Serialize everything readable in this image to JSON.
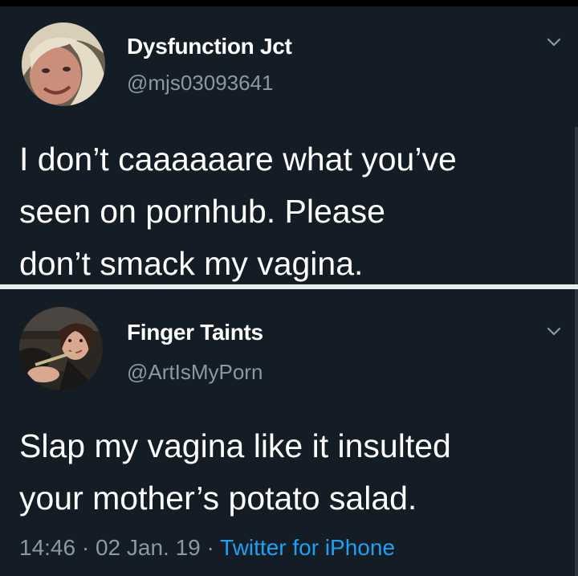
{
  "tweets": [
    {
      "display_name": "Dysfunction Jct",
      "handle": "@mjs03093641",
      "text": "I don’t caaaaaare what you’ve\nseen on pornhub.  Please\ndon’t smack my vagina.",
      "menu_icon": "chevron-down-icon"
    },
    {
      "display_name": "Finger Taints",
      "handle": "@ArtIsMyPorn",
      "text": "Slap my vagina like it insulted\nyour mother’s potato salad.",
      "menu_icon": "chevron-down-icon",
      "time": "14:46",
      "sep1": " · ",
      "date": "02 Jan. 19",
      "sep2": " · ",
      "source": "Twitter for iPhone"
    }
  ],
  "colors": {
    "background": "#141d26",
    "secondary_text": "#8899a6",
    "link": "#1da1f2",
    "divider": "#e8ecef"
  }
}
